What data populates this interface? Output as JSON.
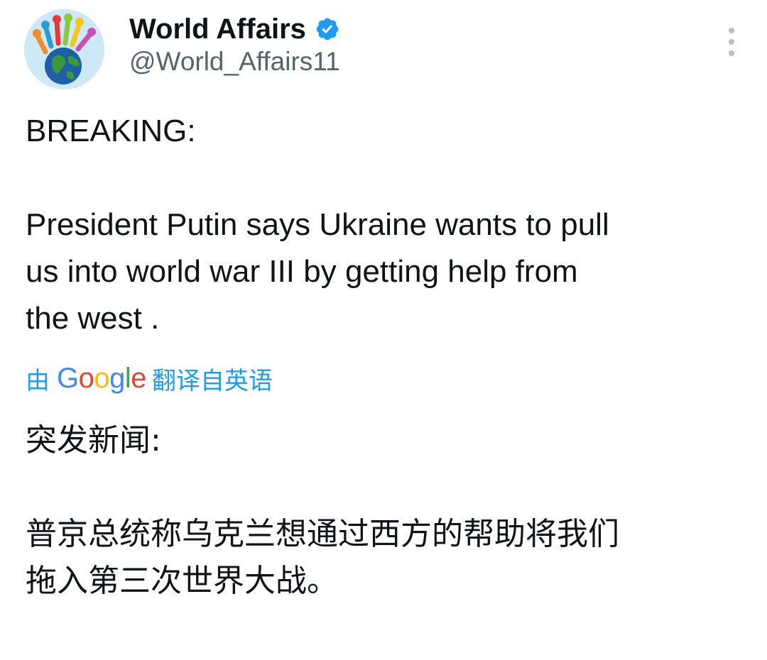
{
  "author": {
    "display_name": "World Affairs",
    "handle": "@World_Affairs11",
    "verified_icon": "verified-badge-icon",
    "avatar_icon": "globe-hands-avatar"
  },
  "tweet": {
    "line_1": "BREAKING:",
    "line_2": "President Putin says Ukraine wants to pull",
    "line_3": "us into world war III by getting help from",
    "line_4": "the west ."
  },
  "translation": {
    "prefix": "由",
    "brand": "Google",
    "suffix": "翻译自英语",
    "line_1": "突发新闻:",
    "line_2": "普京总统称乌克兰想通过西方的帮助将我们",
    "line_3": "拖入第三次世界大战。"
  },
  "colors": {
    "text": "#0f1419",
    "handle": "#536471",
    "link": "#1d9bf0",
    "verified": "#1d9bf0"
  }
}
